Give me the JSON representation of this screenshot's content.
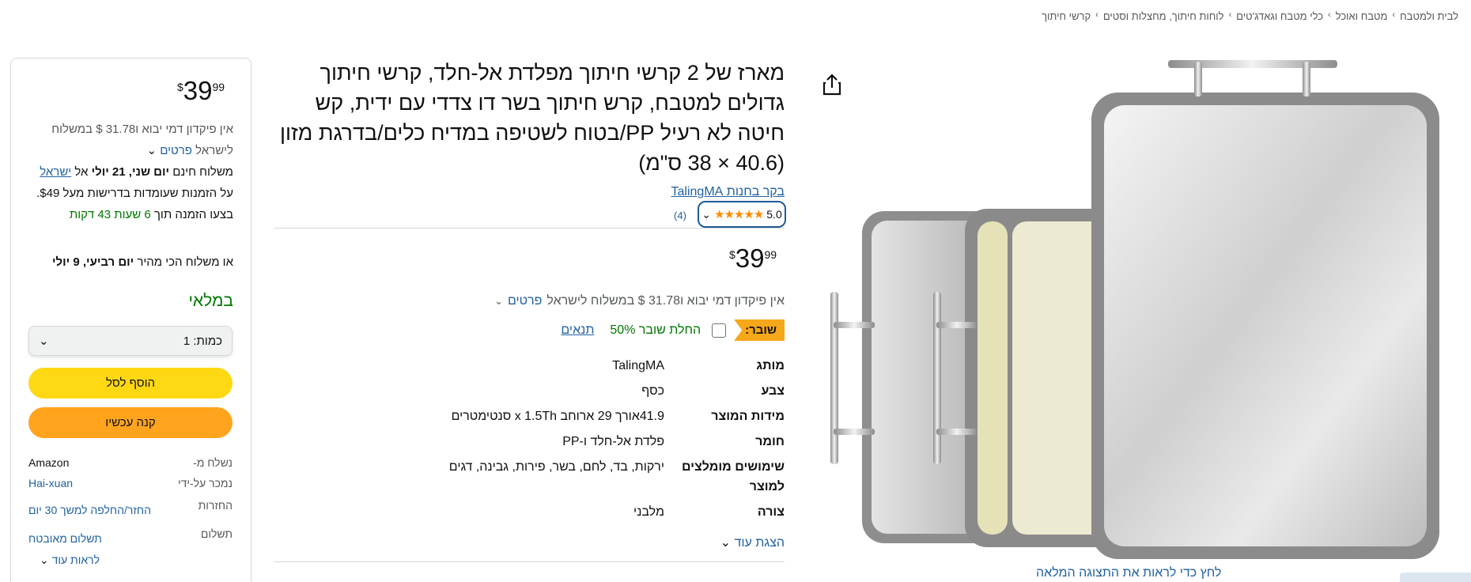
{
  "breadcrumb": [
    "לבית ולמטבח",
    "מטבח ואוכל",
    "כלי מטבח וגאדג'טים",
    "לוחות חיתוך, מחצלות וסטים",
    "קרשי חיתוך"
  ],
  "breadcrumb_sep": "›",
  "image": {
    "zoom_hint": "לחץ כדי לראות את התצוגה המלאה"
  },
  "product": {
    "title": "מארז של 2 קרשי חיתוך מפלדת אל-חלד, קרשי חיתוך גדולים למטבח, קרש חיתוך בשר דו צדדי עם ידית, קש חיטה לא רעיל PP/בטוח לשטיפה במדיח כלים/בדרגת מזון (40.6 × 38 ס\"מ)",
    "store_link": "בקר בחנות TalingMA",
    "rating_value": "5.0",
    "stars": "★★★★★",
    "rating_count": "(4)",
    "price": {
      "currency": "$",
      "whole": "39",
      "fraction": "99"
    },
    "import_text": "אין פיקדון דמי יבוא ו31.78 $ במשלוח לישראל",
    "import_details": "פרטים",
    "coupon": {
      "badge": "שובר:",
      "apply_text": "החלת שובר 50%",
      "terms": "תנאים"
    },
    "specs": [
      {
        "key": "מותג",
        "value": "TalingMA"
      },
      {
        "key": "צבע",
        "value": "כסף"
      },
      {
        "key": "מידות המוצר",
        "value": "41.9אורך 29 ארוחב x 1.5Th סנטימטרים"
      },
      {
        "key": "חומר",
        "value": "פלדת אל-חלד ו-PP"
      },
      {
        "key": "שימושים מומלצים למוצר",
        "value": "ירקות, בד, לחם, בשר, פירות, גבינה, דגים"
      },
      {
        "key": "צורה",
        "value": "מלבני"
      }
    ],
    "see_more": "הצגת עוד"
  },
  "buybox": {
    "price": {
      "currency": "$",
      "whole": "39",
      "fraction": "99"
    },
    "import_text": "אין פיקדון דמי יבוא ו31.78 $ במשלוח לישראל",
    "import_details": "פרטים",
    "delivery_prefix": "משלוח חינם",
    "delivery_date": "יום שני, 21 יולי",
    "delivery_to": "אל",
    "delivery_country": "ישראל",
    "delivery_condition": "על הזמנות שעומדות בדרישות מעל $49. בצעו הזמנה תוך",
    "countdown": "6 שעות 43 דקות",
    "fastest_prefix": "או משלוח הכי מהיר",
    "fastest_date": "יום רביעי, 9 יולי",
    "stock": "במלאי",
    "quantity_label": "כמות:",
    "quantity_value": "1",
    "add_to_cart": "הוסף לסל",
    "buy_now": "קנה עכשיו",
    "rows": [
      {
        "key": "נשלח מ-",
        "value": "Amazon",
        "link": false
      },
      {
        "key": "נמכר על-ידי",
        "value": "Hai-xuan",
        "link": true
      },
      {
        "key": "החזרות",
        "value": "החזר/החלפה למשך 30 יום",
        "link": true
      },
      {
        "key": "תשלום",
        "value": "תשלום מאובטח",
        "link": true
      }
    ],
    "see_more": "לראות עוד"
  },
  "colors": {
    "accent_link": "#2162a1",
    "in_stock": "#007600",
    "add_to_cart": "#ffd814",
    "buy_now": "#ffa41c",
    "coupon": "#f7a71a",
    "stars": "#ff8a00"
  },
  "icons": [
    "share-icon",
    "chevron-down-icon",
    "star-icon"
  ]
}
